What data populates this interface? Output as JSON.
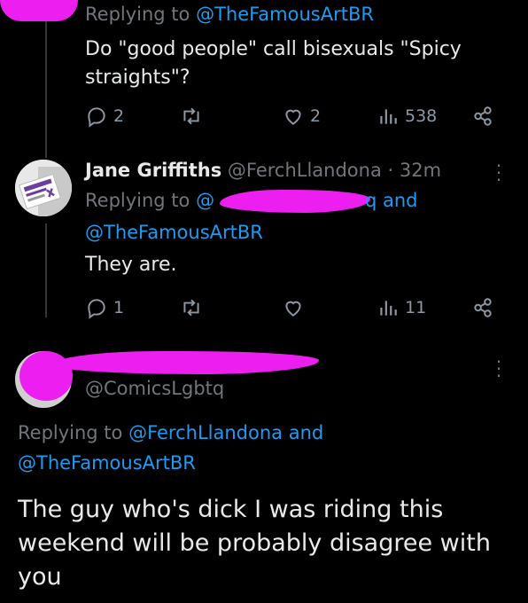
{
  "tweet1": {
    "replying_prefix": "Replying to ",
    "replying_handle": "@TheFamousArtBR",
    "text_line1": "Do \"good people\" call bisexuals \"Spicy",
    "text_line2": "straights\"?",
    "replies": "2",
    "likes": "2",
    "views": "538"
  },
  "tweet2": {
    "name": "Jane Griffiths",
    "handle": "@FerchLlandona",
    "time": "· 32m",
    "replying_prefix": "Replying to ",
    "replying_handle_partial": "@",
    "replying_handle_tail": "q and",
    "replying_handle2": "@TheFamousArtBR",
    "text": "They are.",
    "replies": "1",
    "views": "11"
  },
  "tweet3": {
    "handle": "@ComicsLgbtq",
    "replying_prefix": "Replying to ",
    "replying_handle": "@FerchLlandona",
    "replying_and": " and",
    "replying_handle2": "@TheFamousArtBR",
    "text_line1": "The guy who's dick I was riding this",
    "text_line2": "weekend will be probably disagree with",
    "text_line3": "you"
  },
  "icons": {
    "reply": "reply-icon",
    "retweet": "retweet-icon",
    "like": "heart-icon",
    "views": "views-icon",
    "share": "share-icon",
    "more": "more-icon"
  },
  "colors": {
    "background": "#000000",
    "text": "#e7e9ea",
    "muted": "#71767b",
    "link": "#1d9bf0",
    "redaction": "#ec1ef0"
  }
}
